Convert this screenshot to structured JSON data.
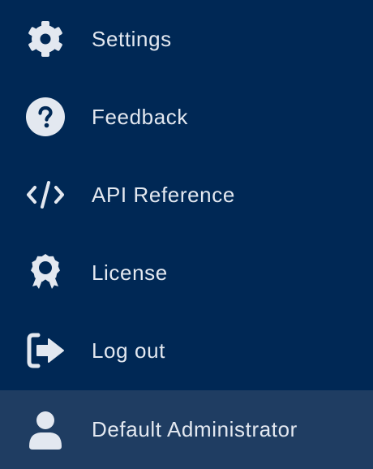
{
  "colors": {
    "background": "#002855",
    "active_row": "#1f3d62",
    "foreground": "#e3e8f0"
  },
  "menu": {
    "items": [
      {
        "label": "Settings",
        "icon": "gear-icon"
      },
      {
        "label": "Feedback",
        "icon": "question-circle-icon"
      },
      {
        "label": "API Reference",
        "icon": "code-icon"
      },
      {
        "label": "License",
        "icon": "award-badge-icon"
      },
      {
        "label": "Log out",
        "icon": "logout-icon"
      }
    ],
    "user": {
      "label": "Default Administrator",
      "icon": "user-icon"
    }
  }
}
